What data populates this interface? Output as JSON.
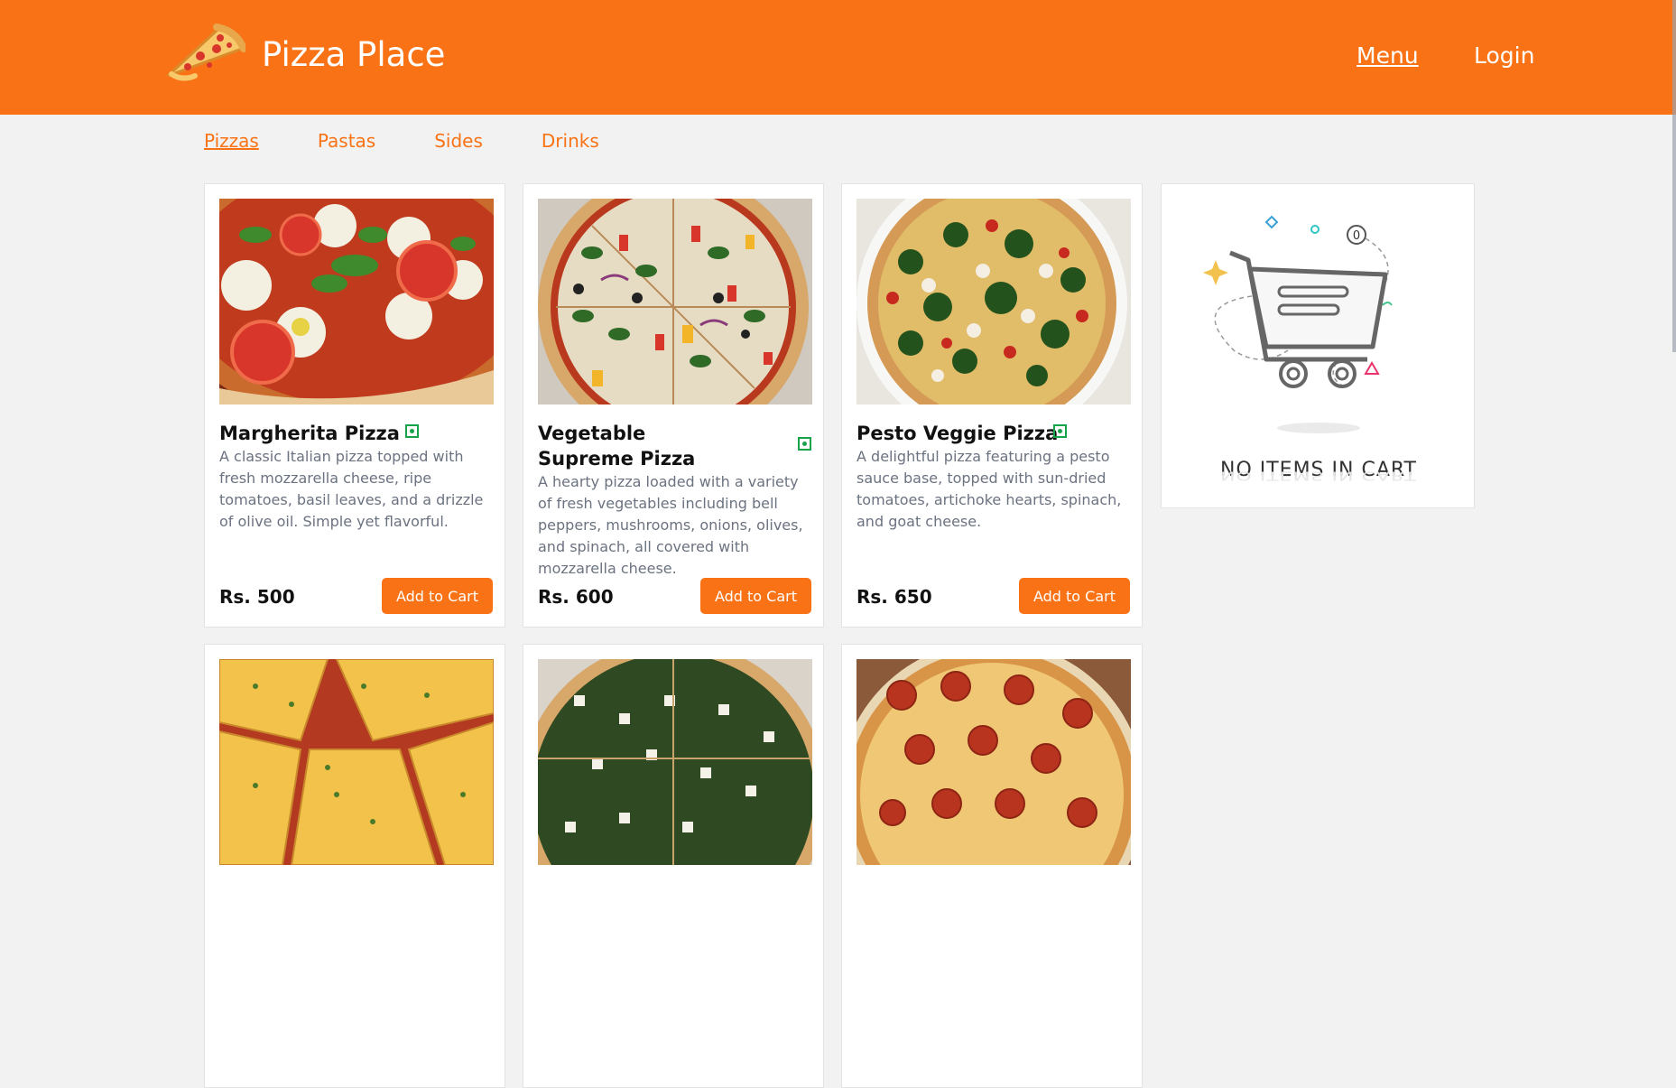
{
  "header": {
    "brand": "Pizza Place",
    "nav": {
      "menu": "Menu",
      "login": "Login"
    },
    "color": "#f97316"
  },
  "tabs": [
    "Pizzas",
    "Pastas",
    "Sides",
    "Drinks"
  ],
  "active_tab": "Pizzas",
  "products": [
    {
      "name": "Margherita Pizza",
      "description": "A classic Italian pizza topped with fresh mozzarella cheese, ripe tomatoes, basil leaves, and a drizzle of olive oil. Simple yet flavorful.",
      "price": "Rs. 500",
      "button": "Add to Cart"
    },
    {
      "name": "Vegetable Supreme Pizza",
      "description": "A hearty pizza loaded with a variety of fresh vegetables including bell peppers, mushrooms, onions, olives, and spinach, all covered with mozzarella cheese.",
      "price": "Rs. 600",
      "button": "Add to Cart"
    },
    {
      "name": "Pesto Veggie Pizza",
      "description": "A delightful pizza featuring a pesto sauce base, topped with sun-dried tomatoes, artichoke hearts, spinach, and goat cheese.",
      "price": "Rs. 650",
      "button": "Add to Cart"
    }
  ],
  "cart": {
    "empty_text": "NO ITEMS IN CART",
    "badge": "0"
  }
}
